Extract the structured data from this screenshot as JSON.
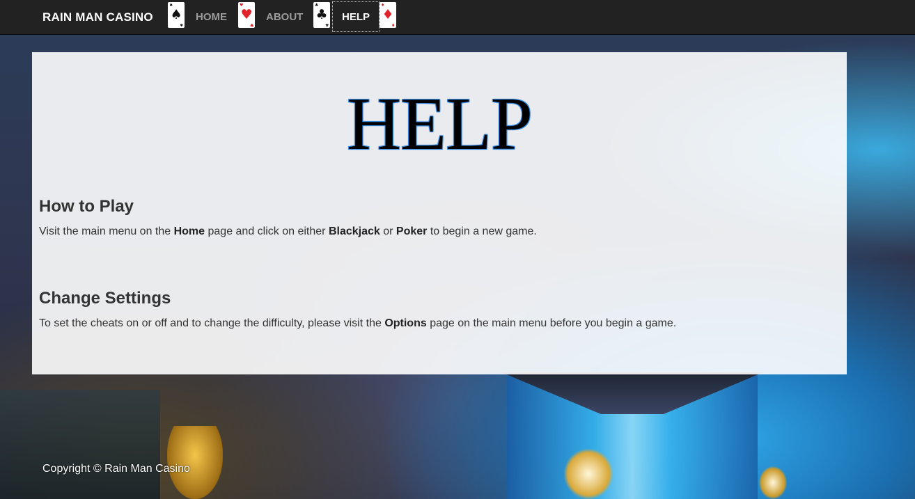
{
  "navbar": {
    "brand": "RAIN MAN CASINO",
    "links": [
      {
        "label": "HOME",
        "active": false
      },
      {
        "label": "ABOUT",
        "active": false
      },
      {
        "label": "HELP",
        "active": true
      }
    ],
    "cards": [
      {
        "suit": "spade-icon",
        "glyph": "♠",
        "color": "#111111"
      },
      {
        "suit": "heart-icon",
        "glyph": "♥",
        "color": "#e0222a"
      },
      {
        "suit": "club-icon",
        "glyph": "♣",
        "color": "#111111"
      },
      {
        "suit": "diamond-icon",
        "glyph": "♦",
        "color": "#e0222a"
      }
    ]
  },
  "main": {
    "title": "HELP",
    "title_outline_color": "#2f86e0",
    "sections": [
      {
        "heading": "How to Play",
        "body": {
          "t1": "Visit the main menu on the ",
          "b1": "Home",
          "t2": " page and click on either ",
          "b2": "Blackjack",
          "t3": " or ",
          "b3": "Poker",
          "t4": " to begin a new game."
        }
      },
      {
        "heading": "Change Settings",
        "body": {
          "t1": "To set the cheats on or off and to change the difficulty, please visit the ",
          "b1": "Options",
          "t2": " page on the main menu before you begin a game."
        }
      }
    ]
  },
  "footer": {
    "copyright": "Copyright © Rain Man Casino"
  }
}
